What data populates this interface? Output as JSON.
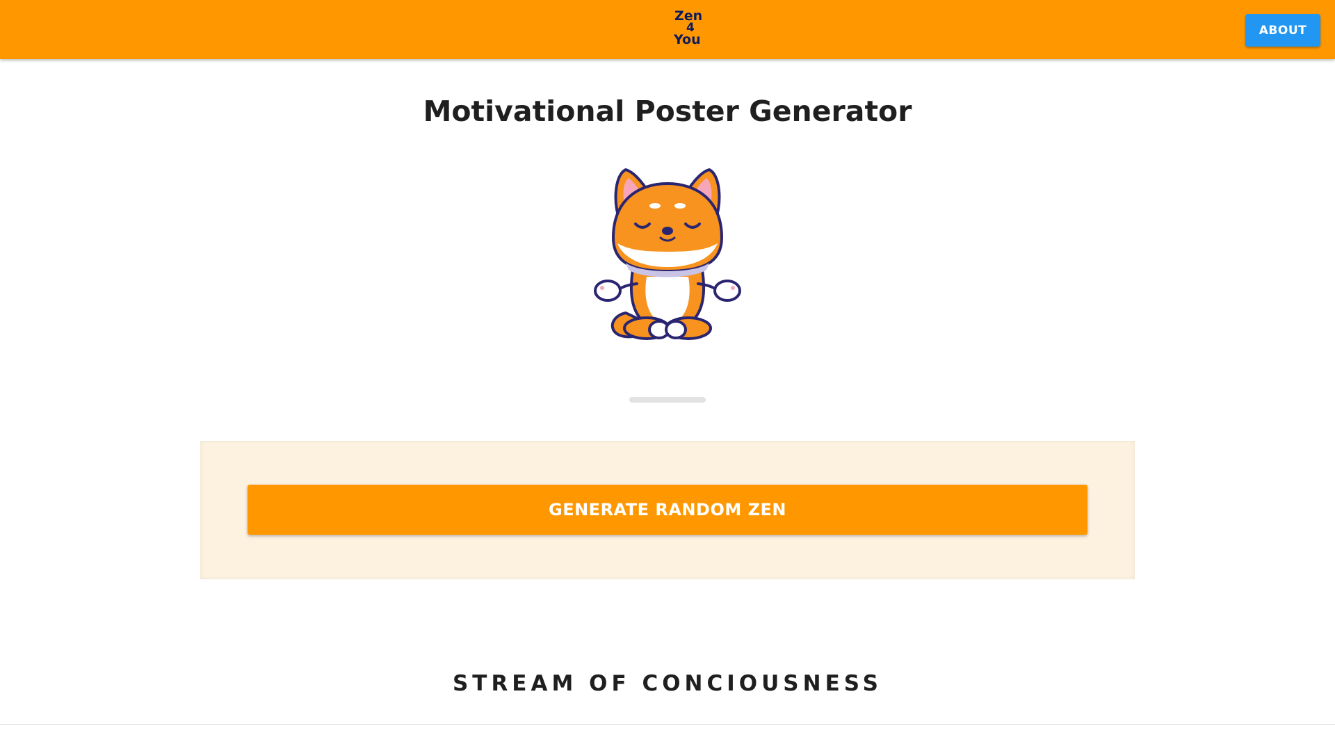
{
  "header": {
    "logo_text": {
      "line1": "Zen",
      "line2": "4",
      "line3": "You"
    },
    "about_label": "ABOUT",
    "bar_color": "#ff9800",
    "about_color": "#2196f3",
    "logo_color": "#0d1a5c"
  },
  "main": {
    "title": "Motivational Poster Generator",
    "mascot_icon": "meditating-shiba-dog-icon",
    "generate_label": "GENERATE RANDOM ZEN",
    "panel_color": "#fdf1e0"
  },
  "stream": {
    "heading": "STREAM OF CONCIOUSNESS"
  }
}
